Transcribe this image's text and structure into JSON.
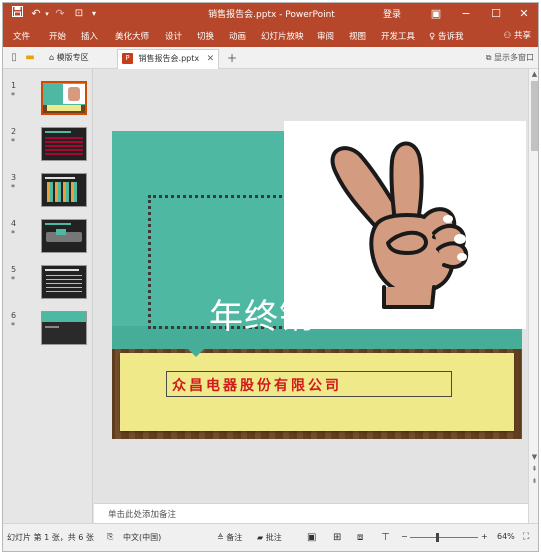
{
  "titlebar": {
    "doc_title": "销售报告会.pptx - PowerPoint",
    "login": "登录",
    "save_icon": "save-icon",
    "undo_icon": "undo-icon",
    "redo_icon": "redo-icon"
  },
  "ribbon": {
    "tabs": [
      "文件",
      "开始",
      "插入",
      "美化大师",
      "设计",
      "切换",
      "动画",
      "幻灯片放映",
      "审阅",
      "视图",
      "开发工具",
      "告诉我"
    ],
    "share": "共享"
  },
  "docbar": {
    "template_tab": "模版专区",
    "active_tab": "销售报告会.pptx",
    "multi_window": "显示多窗口",
    "add": "+"
  },
  "thumbnails": [
    {
      "num": "1",
      "star": "*"
    },
    {
      "num": "2",
      "star": "*"
    },
    {
      "num": "3",
      "star": "*"
    },
    {
      "num": "4",
      "star": "*"
    },
    {
      "num": "5",
      "star": "*"
    },
    {
      "num": "6",
      "star": "*"
    }
  ],
  "slide": {
    "title": "年终销",
    "company": "众昌电器股份有限公司"
  },
  "notes": {
    "placeholder": "单击此处添加备注"
  },
  "statusbar": {
    "slide_info": "幻灯片 第 1 张，共 6 张",
    "language": "中文(中国)",
    "notes_btn": "备注",
    "comments_btn": "批注",
    "zoom": "64%",
    "zoom_minus": "−",
    "zoom_plus": "+"
  },
  "colors": {
    "accent": "#b7472a",
    "slide_teal": "#4fb8a3",
    "note_yellow": "#efe98a",
    "company_red": "#d11b1b"
  }
}
